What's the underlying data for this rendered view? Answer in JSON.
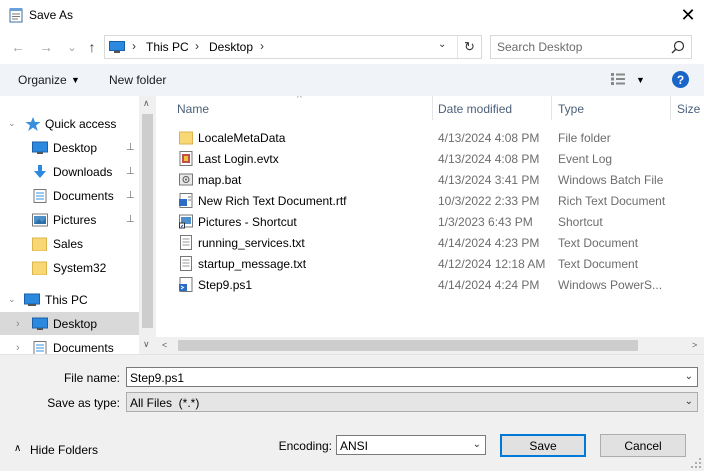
{
  "window": {
    "title": "Save As",
    "close_glyph": "✕"
  },
  "nav": {
    "back_glyph": "←",
    "forward_glyph": "→",
    "recent_glyph": "⌄",
    "up_glyph": "↑",
    "breadcrumb": [
      "This PC",
      "Desktop"
    ],
    "crumb_sep": "›",
    "dropdown_glyph": "⌄",
    "refresh_glyph": "↻"
  },
  "search": {
    "placeholder": "Search Desktop"
  },
  "toolbar": {
    "organize": "Organize",
    "caret": "▼",
    "new_folder": "New folder",
    "help": "?"
  },
  "sidebar": {
    "items": [
      {
        "label": "Quick access",
        "icon": "star-icon",
        "expander": "⌄",
        "pinned": false,
        "selected": false
      },
      {
        "label": "Desktop",
        "icon": "desktop-icon",
        "pinned": true,
        "selected": false
      },
      {
        "label": "Downloads",
        "icon": "download-icon",
        "pinned": true,
        "selected": false
      },
      {
        "label": "Documents",
        "icon": "documents-icon",
        "pinned": true,
        "selected": false
      },
      {
        "label": "Pictures",
        "icon": "pictures-icon",
        "pinned": true,
        "selected": false
      },
      {
        "label": "Sales",
        "icon": "folder-icon",
        "pinned": false,
        "selected": false
      },
      {
        "label": "System32",
        "icon": "folder-icon",
        "pinned": false,
        "selected": false
      },
      {
        "label": "This PC",
        "icon": "computer-icon",
        "expander": "⌄",
        "pinned": false,
        "selected": false
      },
      {
        "label": "Desktop",
        "icon": "desktop-icon",
        "expander": "›",
        "pinned": false,
        "selected": true
      },
      {
        "label": "Documents",
        "icon": "documents-icon",
        "expander": "›",
        "pinned": false,
        "selected": false
      }
    ],
    "pin_glyph": "📌"
  },
  "columns": {
    "name": "Name",
    "date": "Date modified",
    "type": "Type",
    "size": "Size",
    "sort_glyph": "^"
  },
  "files": [
    {
      "name": "LocaleMetaData",
      "date": "4/13/2024 4:08 PM",
      "type": "File folder",
      "icon": "folder-icon"
    },
    {
      "name": "Last Login.evtx",
      "date": "4/13/2024 4:08 PM",
      "type": "Event Log",
      "icon": "event-log-icon"
    },
    {
      "name": "map.bat",
      "date": "4/13/2024 3:41 PM",
      "type": "Windows Batch File",
      "icon": "batch-file-icon"
    },
    {
      "name": "New Rich Text Document.rtf",
      "date": "10/3/2022 2:33 PM",
      "type": "Rich Text Document",
      "icon": "rtf-document-icon"
    },
    {
      "name": "Pictures - Shortcut",
      "date": "1/3/2023 6:43 PM",
      "type": "Shortcut",
      "icon": "shortcut-icon"
    },
    {
      "name": "running_services.txt",
      "date": "4/14/2024 4:23 PM",
      "type": "Text Document",
      "icon": "text-document-icon"
    },
    {
      "name": "startup_message.txt",
      "date": "4/12/2024 12:18 AM",
      "type": "Text Document",
      "icon": "text-document-icon"
    },
    {
      "name": "Step9.ps1",
      "date": "4/14/2024 4:24 PM",
      "type": "Windows PowerS...",
      "icon": "powershell-icon"
    }
  ],
  "scroll": {
    "up": "∧",
    "down": "∨",
    "left": "<",
    "right": ">"
  },
  "form": {
    "filename_label": "File name:",
    "filename_value": "Step9.ps1",
    "savetype_label": "Save as type:",
    "savetype_value": "All Files  (*.*)",
    "encoding_label": "Encoding:",
    "encoding_value": "ANSI",
    "dropdown_glyph": "⌄"
  },
  "footer": {
    "hide_folders": "Hide Folders",
    "hide_caret": "∧",
    "save": "Save",
    "cancel": "Cancel"
  }
}
